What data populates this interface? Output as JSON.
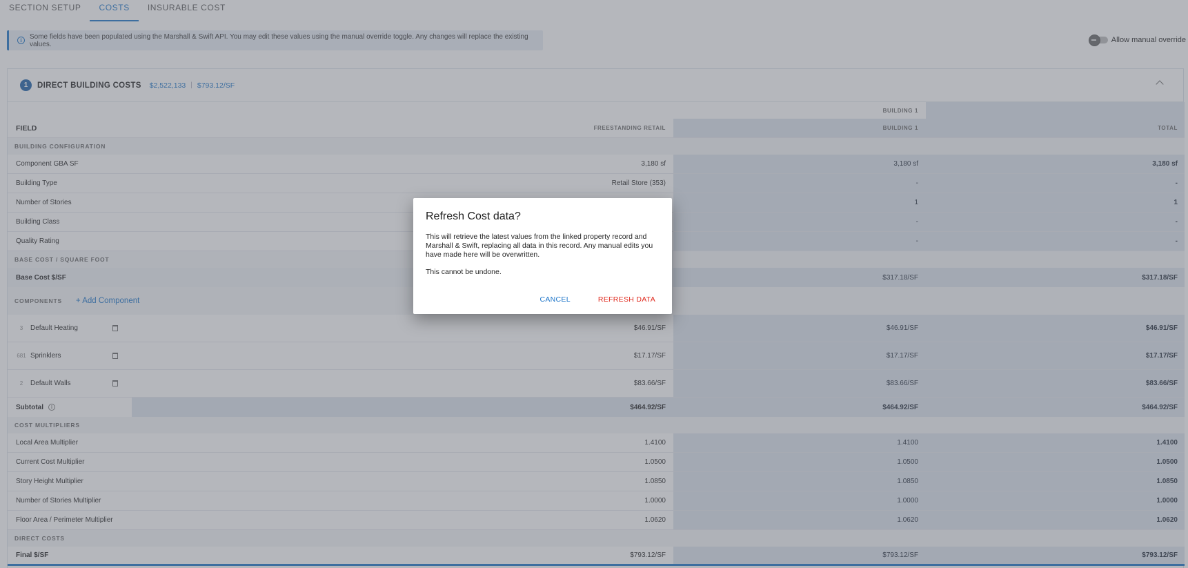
{
  "tabs": [
    "SECTION SETUP",
    "COSTS",
    "INSURABLE COST"
  ],
  "info_banner": "Some fields have been populated using the Marshall & Swift API. You may edit these values using the manual override toggle. Any changes will replace the existing values.",
  "override_label": "Allow manual override",
  "section": {
    "number": "1",
    "title": "DIRECT BUILDING COSTS",
    "total": "$2,522,133",
    "per_sf": "$793.12/SF"
  },
  "table": {
    "group_header": "BUILDING 1",
    "headers": {
      "field": "FIELD",
      "freestanding": "FREESTANDING RETAIL",
      "building": "BUILDING 1",
      "total": "TOTAL"
    },
    "building_config_label": "BUILDING CONFIGURATION",
    "building_config": [
      {
        "field": "Component GBA SF",
        "fr": "3,180 sf",
        "b1": "3,180 sf",
        "total": "3,180 sf"
      },
      {
        "field": "Building Type",
        "fr": "Retail Store (353)",
        "b1": "-",
        "total": "-"
      },
      {
        "field": "Number of Stories",
        "fr": "",
        "b1": "1",
        "total": "1"
      },
      {
        "field": "Building Class",
        "fr": "",
        "b1": "-",
        "total": "-"
      },
      {
        "field": "Quality Rating",
        "fr": "",
        "b1": "-",
        "total": "-"
      }
    ],
    "base_cost_label": "BASE COST / SQUARE FOOT",
    "base_cost": {
      "field": "Base Cost $/SF",
      "fr": "",
      "b1": "$317.18/SF",
      "total": "$317.18/SF"
    },
    "components_label": "COMPONENTS",
    "add_component": "+ Add Component",
    "components": [
      {
        "num": "3",
        "field": "Default Heating",
        "fr": "$46.91/SF",
        "b1": "$46.91/SF",
        "total": "$46.91/SF"
      },
      {
        "num": "681",
        "field": "Sprinklers",
        "fr": "$17.17/SF",
        "b1": "$17.17/SF",
        "total": "$17.17/SF"
      },
      {
        "num": "2",
        "field": "Default Walls",
        "fr": "$83.66/SF",
        "b1": "$83.66/SF",
        "total": "$83.66/SF"
      }
    ],
    "subtotal": {
      "field": "Subtotal",
      "fr": "$464.92/SF",
      "b1": "$464.92/SF",
      "total": "$464.92/SF"
    },
    "multipliers_label": "COST MULTIPLIERS",
    "multipliers": [
      {
        "field": "Local Area Multiplier",
        "fr": "1.4100",
        "b1": "1.4100",
        "total": "1.4100"
      },
      {
        "field": "Current Cost Multiplier",
        "fr": "1.0500",
        "b1": "1.0500",
        "total": "1.0500"
      },
      {
        "field": "Story Height Multiplier",
        "fr": "1.0850",
        "b1": "1.0850",
        "total": "1.0850"
      },
      {
        "field": "Number of Stories Multiplier",
        "fr": "1.0000",
        "b1": "1.0000",
        "total": "1.0000"
      },
      {
        "field": "Floor Area / Perimeter Multiplier",
        "fr": "1.0620",
        "b1": "1.0620",
        "total": "1.0620"
      }
    ],
    "direct_costs_label": "DIRECT COSTS",
    "final": {
      "field": "Final $/SF",
      "fr": "$793.12/SF",
      "b1": "$793.12/SF",
      "total": "$793.12/SF"
    }
  },
  "dialog": {
    "title": "Refresh Cost data?",
    "body": "This will retrieve the latest values from the linked property record and Marshall & Swift, replacing all data in this record. Any manual edits you have made here will be overwritten.",
    "warning": "This cannot be undone.",
    "cancel": "CANCEL",
    "confirm": "REFRESH DATA"
  }
}
